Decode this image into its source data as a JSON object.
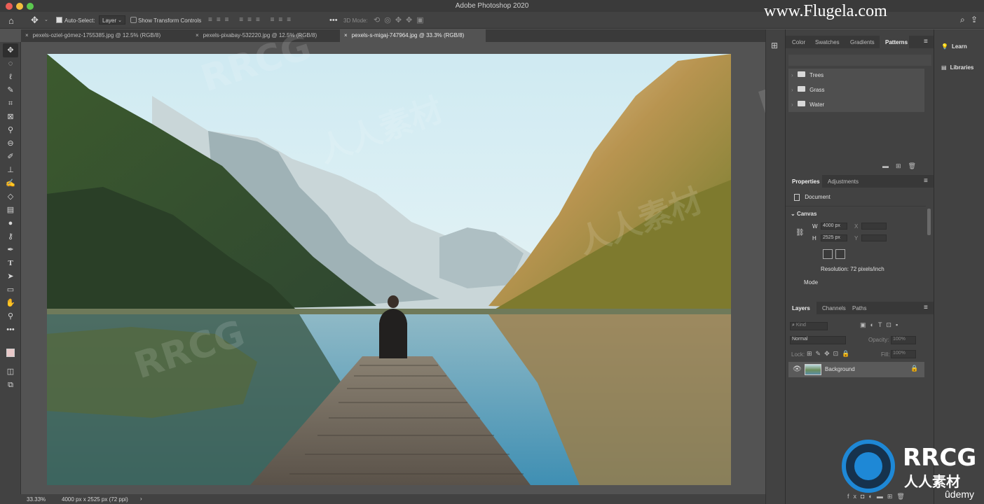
{
  "app": {
    "title": "Adobe Photoshop 2020",
    "watermark_url": "www.Flugela.com"
  },
  "options_bar": {
    "auto_select_label": "Auto-Select:",
    "auto_select_value": "Layer",
    "show_transform_label": "Show Transform Controls",
    "more_label": "•••",
    "mode_3d_label": "3D Mode:"
  },
  "tabs": [
    {
      "label": "pexels-oziel-gómez-1755385.jpg @ 12.5% (RGB/8)"
    },
    {
      "label": "pexels-pixabay-532220.jpg @ 12.5% (RGB/8)"
    },
    {
      "label": "pexels-s-migaj-747964.jpg @ 33.3% (RGB/8)"
    }
  ],
  "status_bar": {
    "zoom": "33.33%",
    "doc_info": "4000 px x 2525 px (72 ppi)",
    "arrow": "›"
  },
  "patterns_panel": {
    "tabs": [
      "Color",
      "Swatches",
      "Gradients",
      "Patterns"
    ],
    "groups": [
      {
        "label": "Trees"
      },
      {
        "label": "Grass"
      },
      {
        "label": "Water"
      }
    ]
  },
  "properties_panel": {
    "tabs": [
      "Properties",
      "Adjustments"
    ],
    "document_label": "Document",
    "canvas_label": "Canvas",
    "w_label": "W",
    "w_value": "4000 px",
    "h_label": "H",
    "h_value": "2525 px",
    "x_label": "X",
    "y_label": "Y",
    "resolution": "Resolution: 72 pixels/inch",
    "mode_label": "Mode"
  },
  "layers_panel": {
    "tabs": [
      "Layers",
      "Channels",
      "Paths"
    ],
    "kind_placeholder": "Kind",
    "blend_mode": "Normal",
    "opacity_label": "Opacity:",
    "opacity_value": "100%",
    "lock_label": "Lock:",
    "fill_label": "Fill:",
    "fill_value": "100%",
    "layer_name": "Background"
  },
  "right_dock": {
    "learn_label": "Learn",
    "libraries_label": "Libraries"
  },
  "branding": {
    "rrcg_title": "RRCG",
    "rrcg_sub": "人人素材",
    "udemy": "ûdemy",
    "wm_text": "人人素材",
    "wm_rrcg": "RRCG"
  },
  "colors": {
    "ui_dark": "#424242",
    "canvas_bg": "#535353",
    "accent_blue": "#1e88d6",
    "active_tab": "#535353"
  }
}
